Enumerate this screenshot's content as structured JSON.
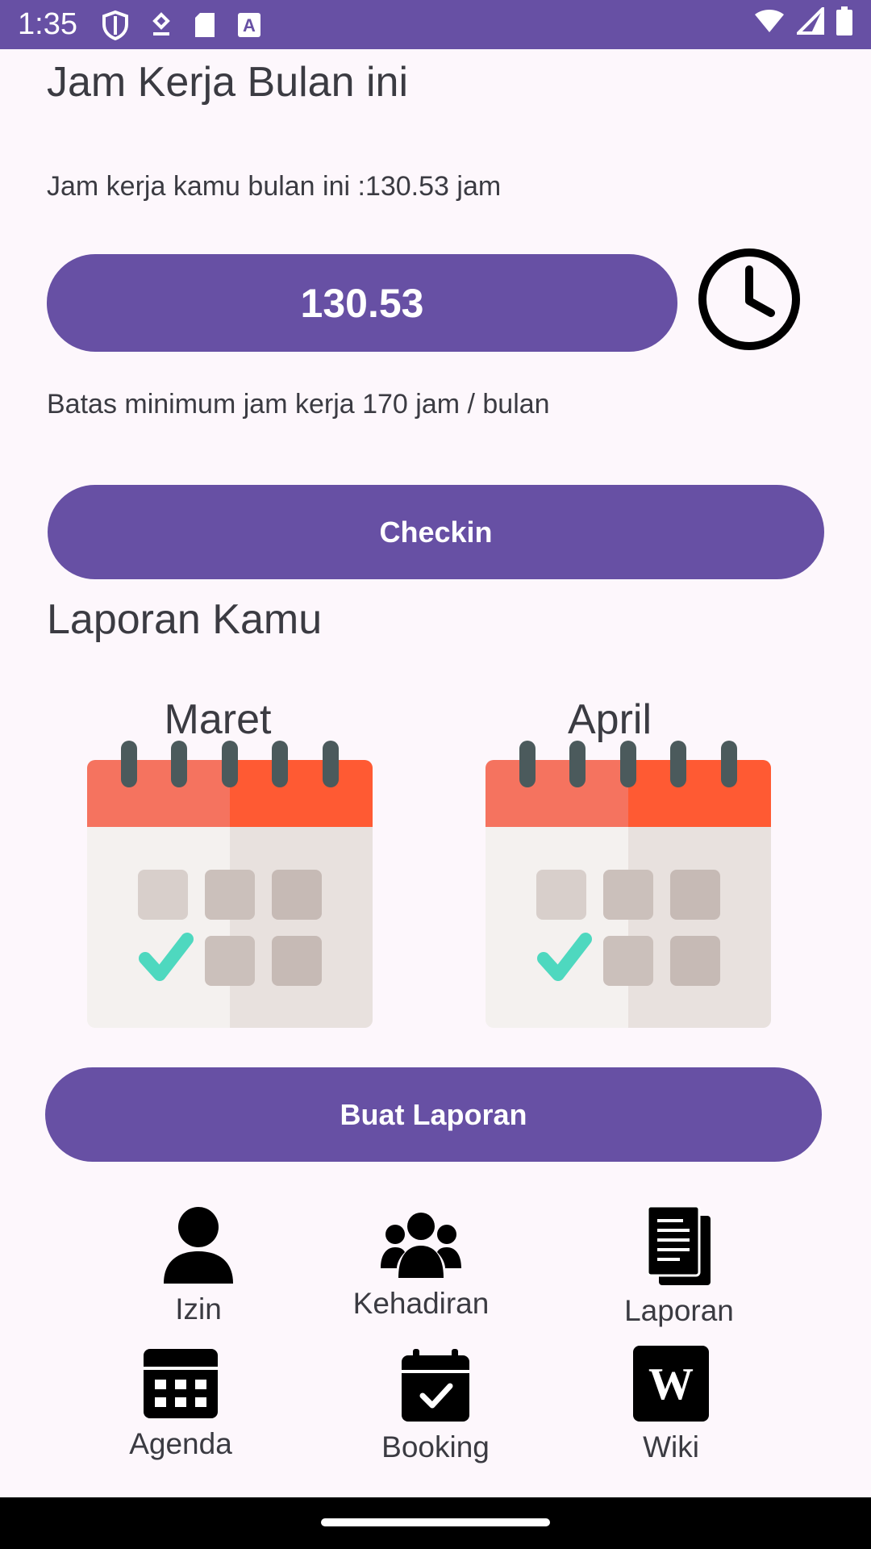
{
  "status_bar": {
    "time": "1:35",
    "left_icons": [
      "shield-icon",
      "location-icon",
      "sd-card-icon",
      "font-icon"
    ],
    "right_icons": [
      "wifi-icon",
      "cell-signal-icon",
      "battery-icon"
    ]
  },
  "work_hours": {
    "title": "Jam Kerja Bulan ini",
    "summary": "Jam kerja kamu bulan ini :130.53 jam",
    "value": "130.53",
    "minimum_note": "Batas minimum jam kerja 170 jam / bulan",
    "checkin_label": "Checkin"
  },
  "reports": {
    "title": "Laporan Kamu",
    "months": [
      "Maret",
      "April"
    ],
    "create_label": "Buat Laporan"
  },
  "menu": [
    {
      "label": "Izin",
      "icon": "person-icon"
    },
    {
      "label": "Kehadiran",
      "icon": "group-icon"
    },
    {
      "label": "Laporan",
      "icon": "document-icon"
    },
    {
      "label": "Agenda",
      "icon": "calendar-grid-icon"
    },
    {
      "label": "Booking",
      "icon": "calendar-check-icon"
    },
    {
      "label": "Wiki",
      "icon": "wikipedia-icon"
    }
  ],
  "colors": {
    "primary": "#6750A4",
    "background": "#FDF7FC",
    "calendar_header": "#F5735F",
    "check": "#4ED8BF"
  }
}
